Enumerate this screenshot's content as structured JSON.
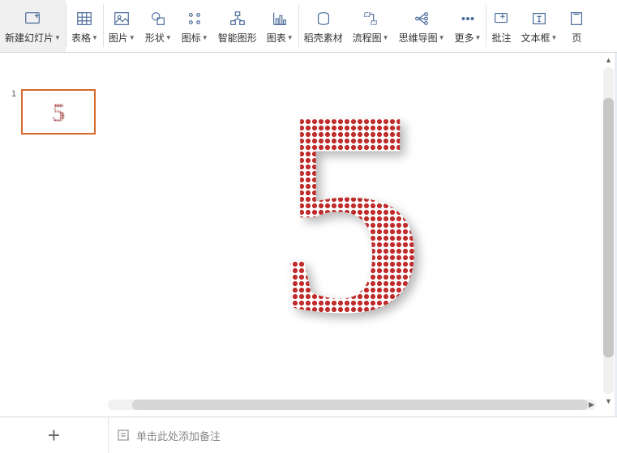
{
  "toolbar": {
    "newSlide": "新建幻灯片",
    "table": "表格",
    "image": "图片",
    "shape": "形状",
    "icon": "图标",
    "smartArt": "智能图形",
    "chart": "图表",
    "dockShell": "稻壳素材",
    "flowchart": "流程图",
    "mindmap": "思维导图",
    "more": "更多",
    "comment": "批注",
    "textbox": "文本框",
    "headerPartial": "页"
  },
  "thumbs": {
    "idx1": "1",
    "content1": "5"
  },
  "canvas": {
    "content": "5"
  },
  "notes": {
    "placeholder": "单击此处添加备注"
  },
  "addSlide": {
    "plus": "+"
  }
}
